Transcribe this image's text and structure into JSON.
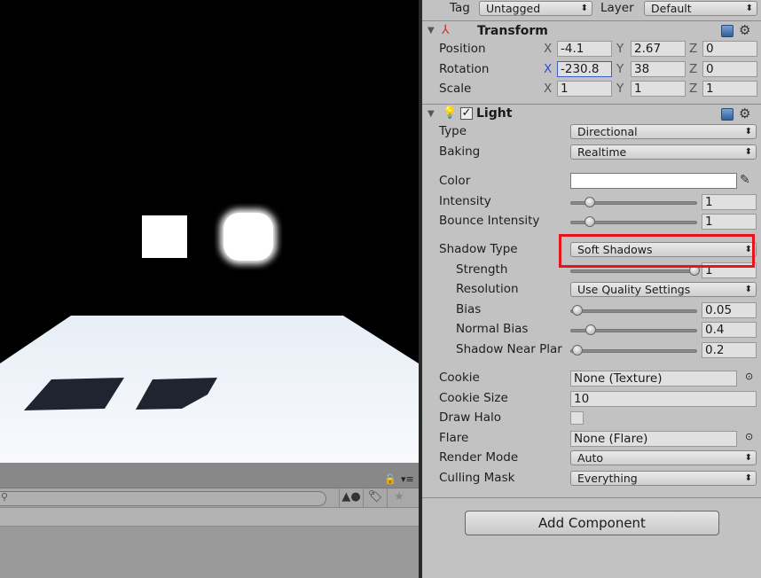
{
  "header": {
    "tag_label": "Tag",
    "tag_value": "Untagged",
    "layer_label": "Layer",
    "layer_value": "Default"
  },
  "transform": {
    "title": "Transform",
    "rows": [
      {
        "label": "Position",
        "x": "-4.1",
        "y": "2.67",
        "z": "0"
      },
      {
        "label": "Rotation",
        "x": "-230.8",
        "y": "38",
        "z": "0"
      },
      {
        "label": "Scale",
        "x": "1",
        "y": "1",
        "z": "1"
      }
    ],
    "axes": {
      "x": "X",
      "y": "Y",
      "z": "Z"
    }
  },
  "light": {
    "title": "Light",
    "enabled": true,
    "type": {
      "label": "Type",
      "value": "Directional"
    },
    "baking": {
      "label": "Baking",
      "value": "Realtime"
    },
    "color": {
      "label": "Color",
      "value": "#ffffff"
    },
    "intensity": {
      "label": "Intensity",
      "value": "1",
      "fraction": 0.125
    },
    "bounce": {
      "label": "Bounce Intensity",
      "value": "1",
      "fraction": 0.125
    },
    "shadow_type": {
      "label": "Shadow Type",
      "value": "Soft Shadows"
    },
    "strength": {
      "label": "Strength",
      "value": "1",
      "fraction": 1
    },
    "resolution": {
      "label": "Resolution",
      "value": "Use Quality Settings"
    },
    "bias": {
      "label": "Bias",
      "value": "0.05",
      "fraction": 0.025
    },
    "normal_bias": {
      "label": "Normal Bias",
      "value": "0.4",
      "fraction": 0.133
    },
    "near_plane": {
      "label": "Shadow Near Plar",
      "value": "0.2",
      "fraction": 0.02
    },
    "cookie": {
      "label": "Cookie",
      "value": "None (Texture)"
    },
    "cookie_size": {
      "label": "Cookie Size",
      "value": "10"
    },
    "draw_halo": {
      "label": "Draw Halo",
      "checked": false
    },
    "flare": {
      "label": "Flare",
      "value": "None (Flare)"
    },
    "render_mode": {
      "label": "Render Mode",
      "value": "Auto"
    },
    "culling_mask": {
      "label": "Culling Mask",
      "value": "Everything"
    }
  },
  "add_component": "Add Component",
  "highlight_color": "#e5141d"
}
